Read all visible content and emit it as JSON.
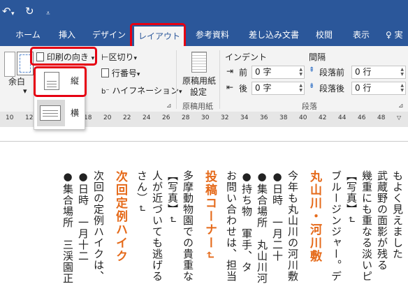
{
  "qat": {
    "undo_icon": "undo-icon",
    "redo_icon": "redo-icon",
    "customize_icon": "qat-customize-icon"
  },
  "tabs": [
    "ホーム",
    "挿入",
    "デザイン",
    "レイアウト",
    "参考資料",
    "差し込み文書",
    "校閲",
    "表示"
  ],
  "tell_me": "実",
  "page_setup": {
    "margin_label": "余白",
    "orientation_label": "印刷の向き",
    "breaks_label": "区切り",
    "line_numbers_label": "行番号",
    "hyphenation_label": "ハイフネーション",
    "group_label": "ページ設定"
  },
  "manuscript": {
    "label_line1": "原稿用紙",
    "label_line2": "設定",
    "group_label": "原稿用紙"
  },
  "paragraph": {
    "indent_title": "インデント",
    "spacing_title": "間隔",
    "before_indent_label": "前",
    "after_indent_label": "後",
    "before_indent_value": "0 字",
    "after_indent_value": "0 字",
    "spacing_before_label": "段落前",
    "spacing_after_label": "段落後",
    "spacing_before_value": "0 行",
    "spacing_after_value": "0 行",
    "group_label": "段落"
  },
  "orientation_menu": {
    "portrait": "縦",
    "landscape": "横"
  },
  "ruler": [
    "10",
    "12",
    "14",
    "16",
    "18",
    "20",
    "22",
    "24",
    "26",
    "28",
    "30",
    "32",
    "34",
    "36",
    "38",
    "40",
    "42",
    "44",
    "46",
    "48"
  ],
  "document_columns": [
    "もよく見えました",
    "武蔵野の面影が残る",
    "幾重にも重なる淡いピ",
    "【写真】↵",
    "ブルージンジャー。デ",
    "丸山川・河川敷",
    "今年も丸山川の河川敷",
    "●日時　一月二十",
    "●集合場所　丸山川河",
    "●持ち物　軍手、タ",
    "お問い合わせは、担当",
    "投稿コーナー↵",
    "多摩動物園での貴重な",
    "【写真】↵",
    "人が近づいても逃げる",
    "さん）↵",
    "次回定例ハイク",
    "次回の定例ハイクは、",
    "●日時　一月十二",
    "●集合場所　三渓園正"
  ]
}
